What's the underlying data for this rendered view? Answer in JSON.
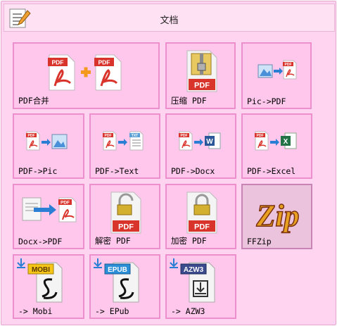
{
  "window": {
    "title": "文档"
  },
  "tiles": [
    {
      "id": "pdf-merge",
      "label": "PDF合并"
    },
    {
      "id": "compress-pdf",
      "label": "压缩 PDF"
    },
    {
      "id": "pic-to-pdf",
      "label": "Pic->PDF"
    },
    {
      "id": "pdf-to-pic",
      "label": "PDF->Pic"
    },
    {
      "id": "pdf-to-text",
      "label": "PDF->Text"
    },
    {
      "id": "pdf-to-docx",
      "label": "PDF->Docx"
    },
    {
      "id": "pdf-to-excel",
      "label": "PDF->Excel"
    },
    {
      "id": "docx-to-pdf",
      "label": "Docx->PDF"
    },
    {
      "id": "decrypt-pdf",
      "label": "解密 PDF"
    },
    {
      "id": "encrypt-pdf",
      "label": "加密 PDF"
    },
    {
      "id": "ffzip",
      "label": "FFZip",
      "selected": true
    },
    {
      "id": "to-mobi",
      "label": "-> Mobi"
    },
    {
      "id": "to-epub",
      "label": "-> EPub"
    },
    {
      "id": "to-azw3",
      "label": "-> AZW3"
    }
  ],
  "icon_text": {
    "pdf": "PDF",
    "txt": "TXT",
    "word": "W",
    "excel": "X",
    "ffzip_logo": "Zip",
    "mobi": "MOBI",
    "epub": "EPUB",
    "azw3": "AZW3"
  },
  "colors": {
    "window_bg": "#ffd4f0",
    "tile_bg": "#ffc7eb",
    "tile_border": "#ec8fcc",
    "pdf_red": "#d9342b",
    "arrow_blue": "#2a7fd4",
    "plus_orange": "#f39a1d",
    "word_blue": "#2b579a",
    "excel_green": "#217346",
    "mobi_yellow": "#f5c518",
    "epub_blue": "#2b8fd8",
    "azw3_navy": "#3a4a8c"
  }
}
